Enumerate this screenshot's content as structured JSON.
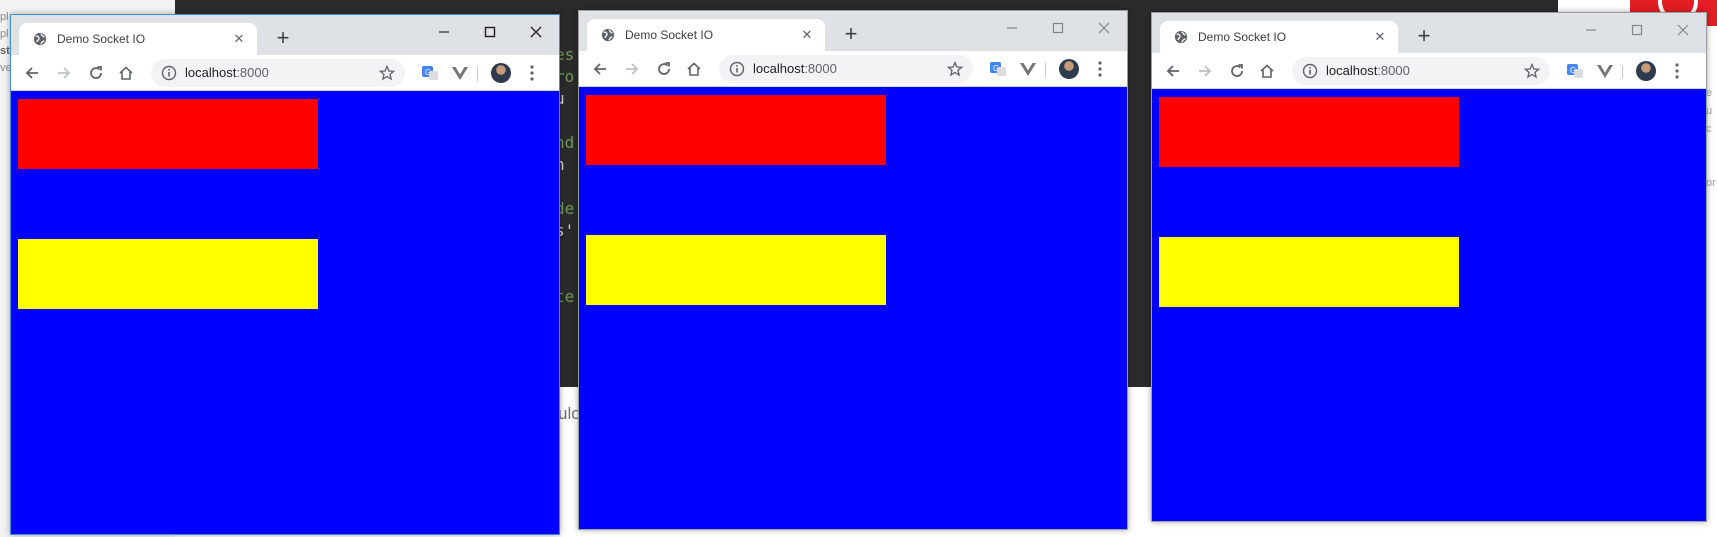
{
  "background": {
    "left_panel_lines": [
      "pl",
      "pl",
      "st",
      "ve"
    ],
    "terminal_fragments": [
      "es",
      "ro",
      "u",
      "",
      "nd",
      " h",
      "",
      "de",
      "s'",
      "",
      "",
      "te"
    ],
    "bottom_text": "ulo",
    "right_panel_lines": [
      "e u",
      "",
      "c",
      "",
      "",
      "or"
    ]
  },
  "colors": {
    "page_bg": "#0000ff",
    "box_top": "#ff0000",
    "box_bottom": "#ffff00"
  },
  "windows": [
    {
      "tab_title": "Demo Socket IO",
      "url_host": "localhost",
      "url_port": ":8000",
      "icons": [
        "globe-icon",
        "tab-close-icon",
        "new-tab-icon",
        "minimize-icon",
        "maximize-icon",
        "close-icon",
        "back-icon",
        "forward-icon",
        "reload-icon",
        "home-icon",
        "info-icon",
        "bookmark-star-icon",
        "translate-extension-icon",
        "vue-devtools-icon",
        "profile-avatar",
        "menu-kebab-icon"
      ]
    },
    {
      "tab_title": "Demo Socket IO",
      "url_host": "localhost",
      "url_port": ":8000"
    },
    {
      "tab_title": "Demo Socket IO",
      "url_host": "localhost",
      "url_port": ":8000"
    }
  ]
}
